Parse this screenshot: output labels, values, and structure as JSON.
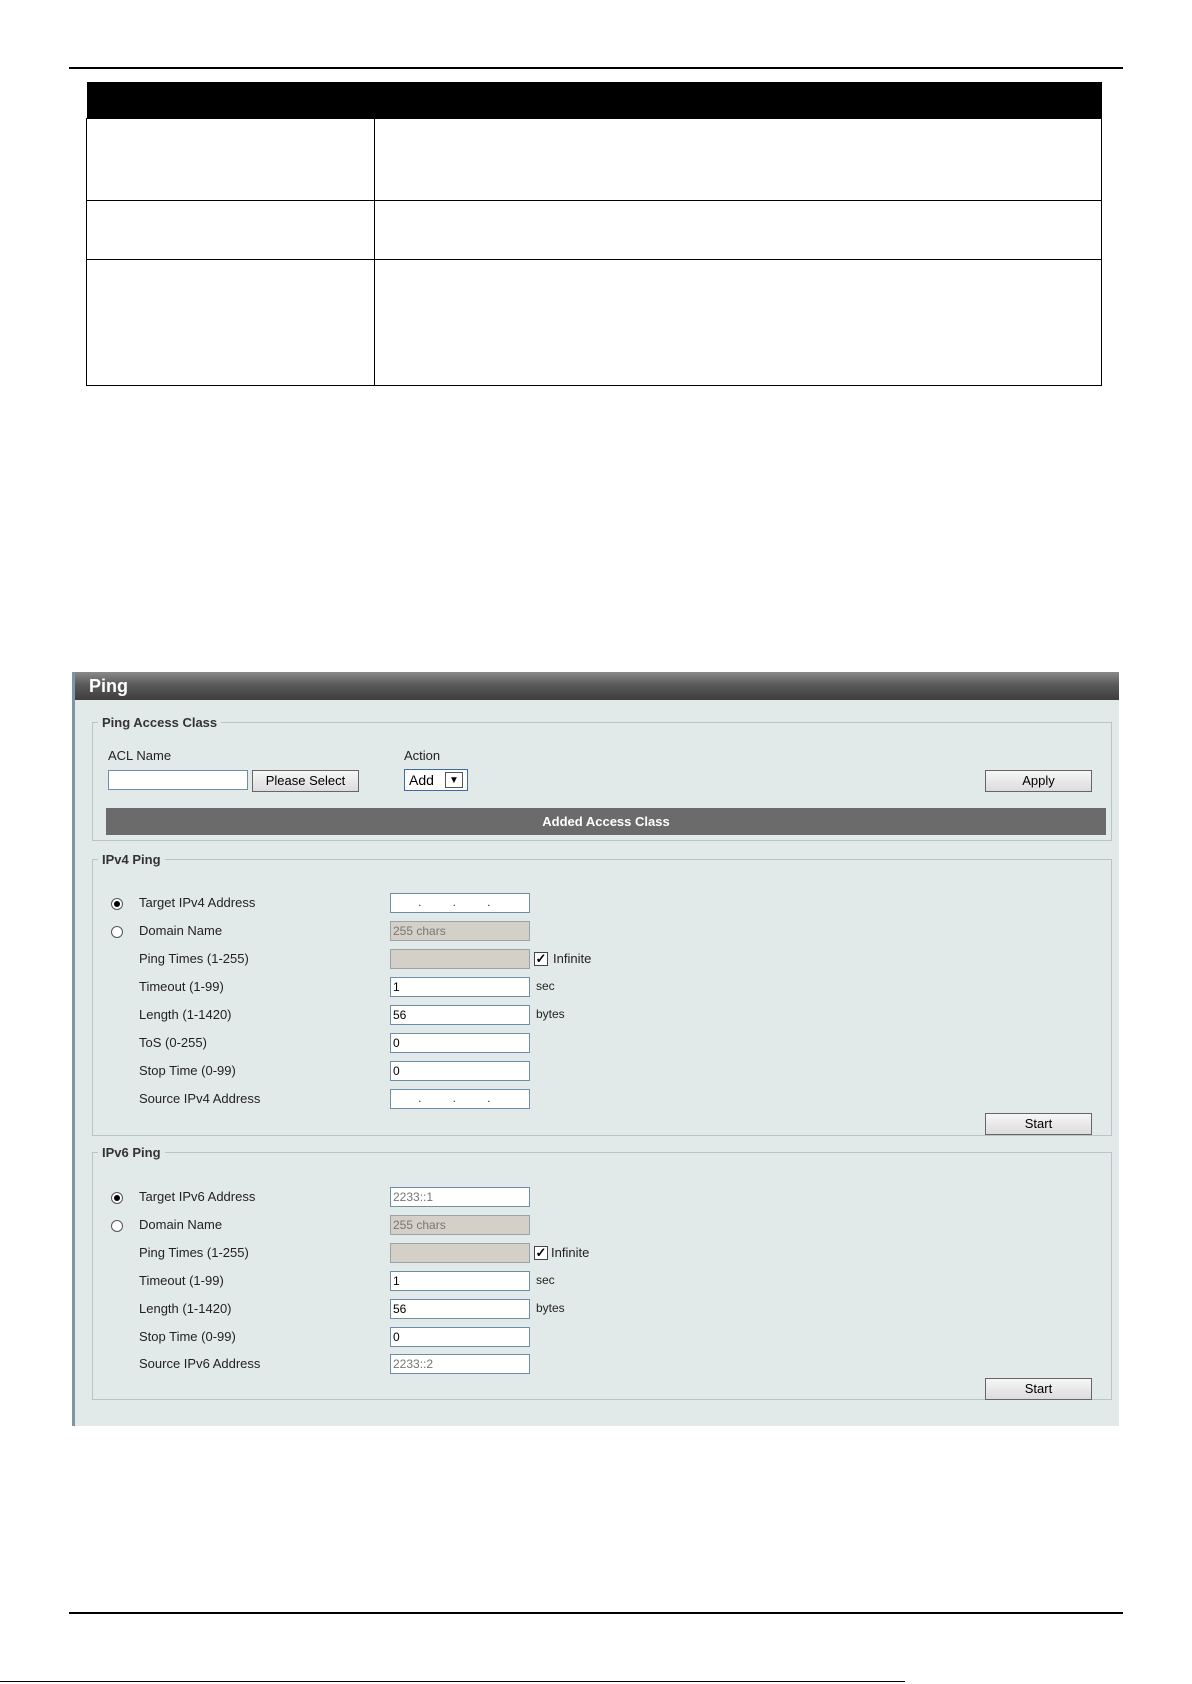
{
  "panel": {
    "title": "Ping"
  },
  "access_class": {
    "legend": "Ping Access Class",
    "acl_label": "ACL Name",
    "acl_value": "",
    "select_button": "Please Select",
    "action_label": "Action",
    "action_value": "Add",
    "apply_button": "Apply",
    "table_header": "Added Access Class"
  },
  "ipv4": {
    "legend": "IPv4 Ping",
    "target_label": "Target IPv4 Address",
    "domain_label": "Domain Name",
    "domain_placeholder": "255 chars",
    "times_label": "Ping Times (1-255)",
    "infinite_label": "Infinite",
    "timeout_label": "Timeout (1-99)",
    "timeout_value": "1",
    "timeout_unit": "sec",
    "length_label": "Length (1-1420)",
    "length_value": "56",
    "length_unit": "bytes",
    "tos_label": "ToS (0-255)",
    "tos_value": "0",
    "stop_label": "Stop Time (0-99)",
    "stop_value": "0",
    "source_label": "Source IPv4 Address",
    "ip_separator": ".",
    "start_button": "Start"
  },
  "ipv6": {
    "legend": "IPv6 Ping",
    "target_label": "Target IPv6 Address",
    "target_value": "2233::1",
    "domain_label": "Domain Name",
    "domain_placeholder": "255 chars",
    "times_label": "Ping Times (1-255)",
    "infinite_label": "Infinite",
    "timeout_label": "Timeout (1-99)",
    "timeout_value": "1",
    "timeout_unit": "sec",
    "length_label": "Length  (1-1420)",
    "length_value": "56",
    "length_unit": "bytes",
    "stop_label": "Stop Time (0-99)",
    "stop_value": "0",
    "source_label": "Source IPv6 Address",
    "source_value": "2233::2",
    "start_button": "Start"
  },
  "state": {
    "ipv4_target_selected": true,
    "ipv4_infinite_checked": true,
    "ipv6_target_selected": true,
    "ipv6_infinite_checked": true
  },
  "checkmark_glyph": "✓",
  "dropdown_arrow_glyph": "▼"
}
